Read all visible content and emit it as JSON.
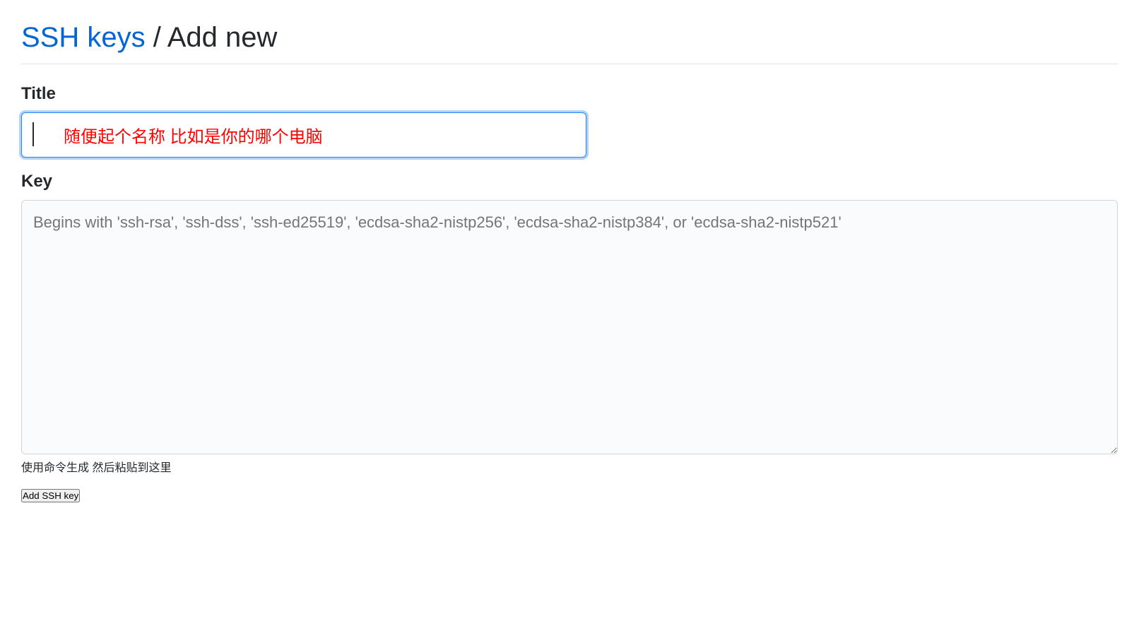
{
  "header": {
    "link_label": "SSH keys",
    "separator": " / ",
    "current": "Add new"
  },
  "form": {
    "title": {
      "label": "Title",
      "value": "",
      "annotation": "随便起个名称  比如是你的哪个电脑"
    },
    "key": {
      "label": "Key",
      "placeholder": "Begins with 'ssh-rsa', 'ssh-dss', 'ssh-ed25519', 'ecdsa-sha2-nistp256', 'ecdsa-sha2-nistp384', or 'ecdsa-sha2-nistp521'",
      "value": "",
      "annotation": "使用命令生成   然后粘贴到这里"
    },
    "submit_label": "Add SSH key"
  }
}
